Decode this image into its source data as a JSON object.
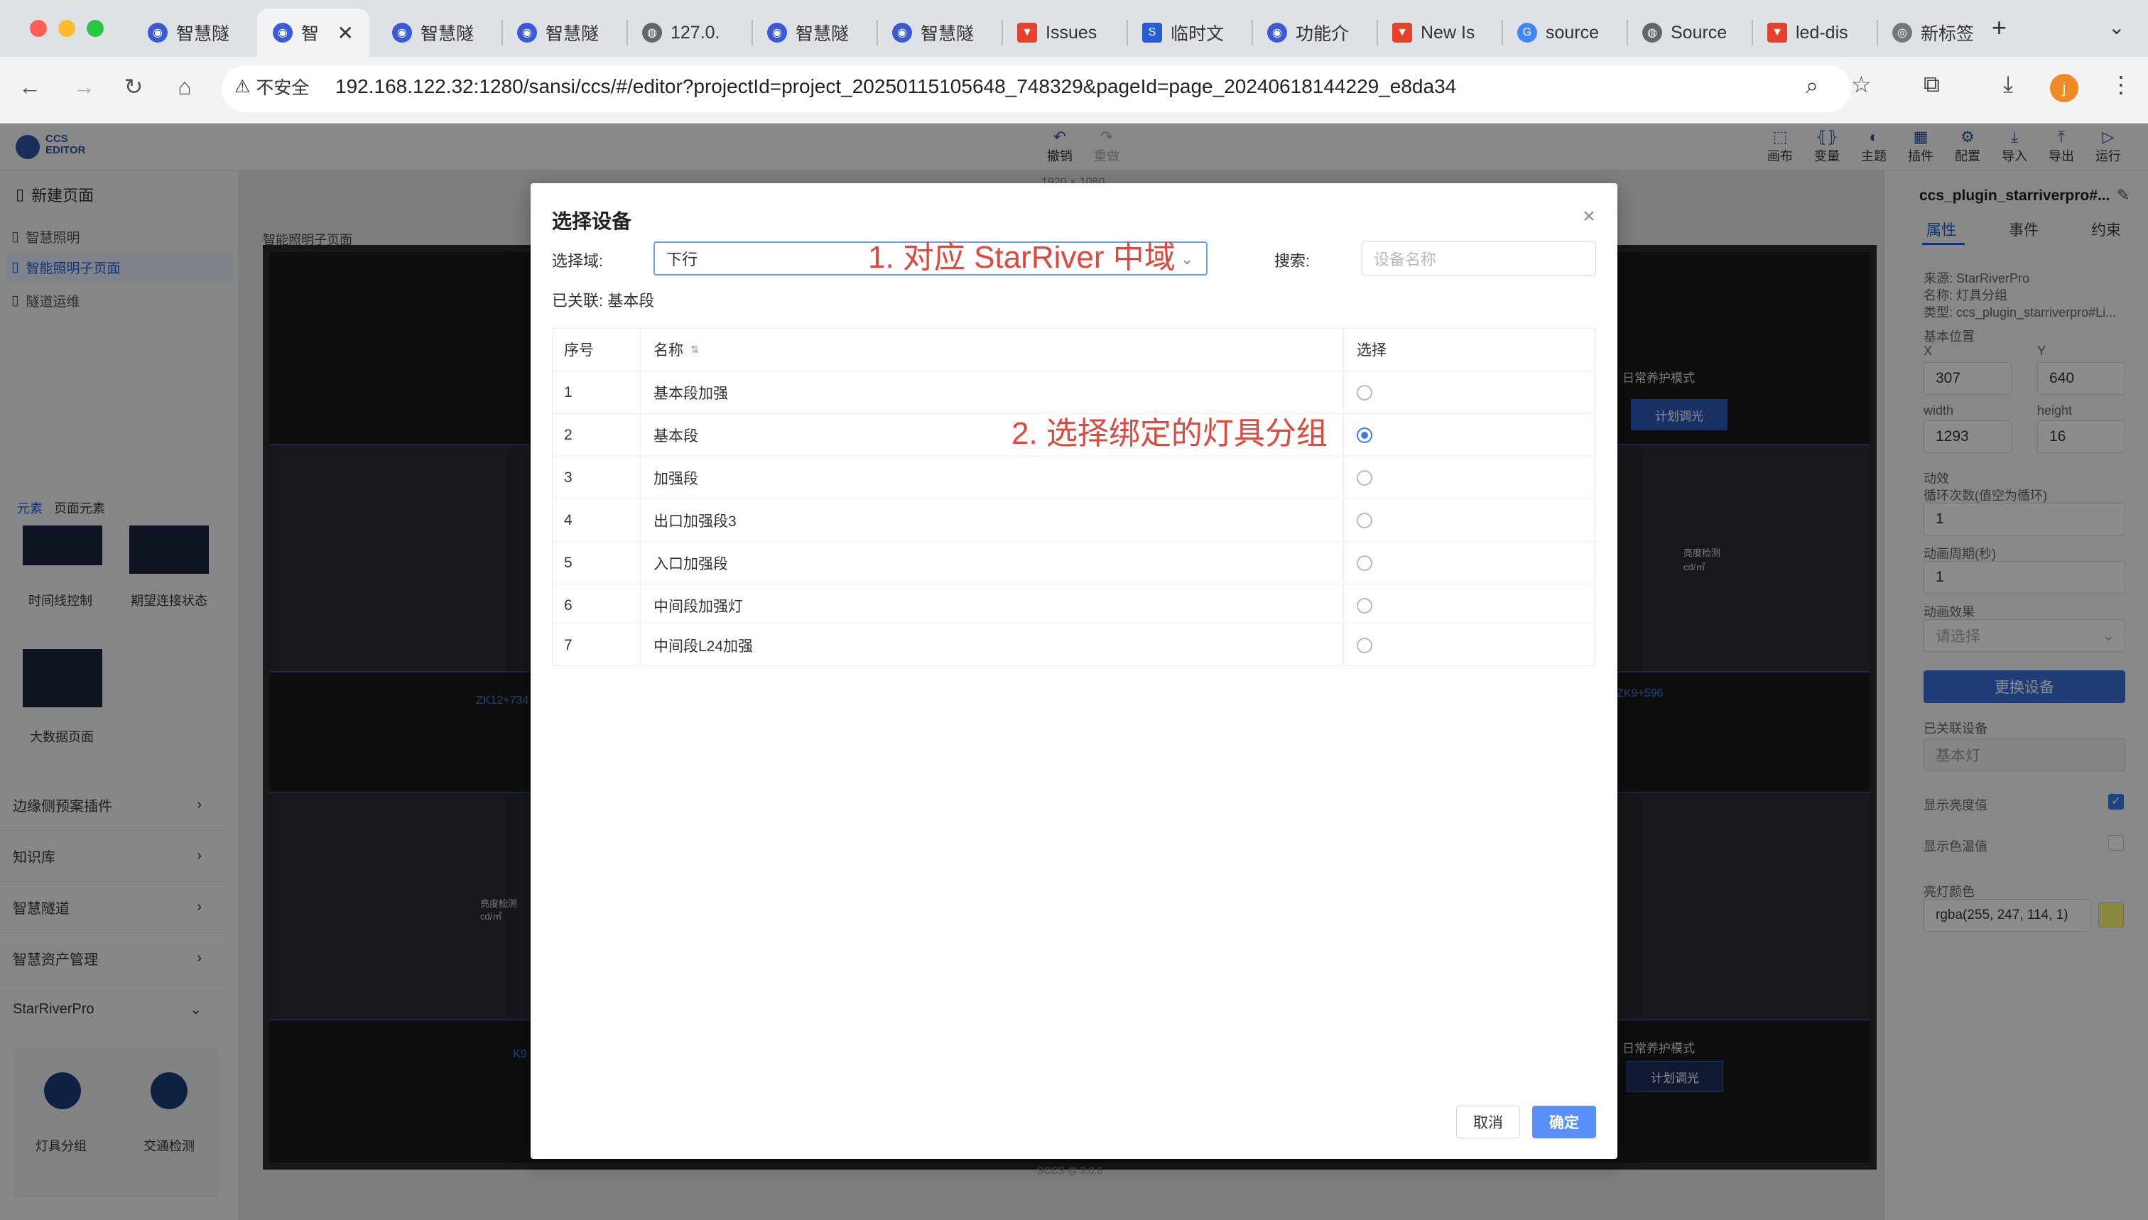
{
  "browser": {
    "tabs": [
      {
        "label": "智慧隧",
        "favicon": "ccs-icon"
      },
      {
        "label": "智",
        "favicon": "ccs-icon"
      },
      {
        "label": "智慧隧",
        "favicon": "ccs-icon"
      },
      {
        "label": "智慧隧",
        "favicon": "ccs-icon"
      },
      {
        "label": "127.0.",
        "favicon": "globe-icon"
      },
      {
        "label": "智慧隧",
        "favicon": "ccs-icon"
      },
      {
        "label": "智慧隧",
        "favicon": "ccs-icon"
      },
      {
        "label": "Issues",
        "favicon": "gitlab-icon"
      },
      {
        "label": "临时文",
        "favicon": "s-icon"
      },
      {
        "label": "功能介",
        "favicon": "ccs-icon"
      },
      {
        "label": "New Is",
        "favicon": "gitlab-icon"
      },
      {
        "label": "source",
        "favicon": "google-icon"
      },
      {
        "label": "Source",
        "favicon": "globe-icon"
      },
      {
        "label": "led-dis",
        "favicon": "gitlab-icon"
      },
      {
        "label": "新标签",
        "favicon": "chrome-icon"
      }
    ],
    "security_label": "不安全",
    "url": "192.168.122.32:1280/sansi/ccs/#/editor?projectId=project_20250115105648_748329&pageId=page_20240618144229_e8da34",
    "profile_initial": "j"
  },
  "app": {
    "logo_line1": "CCS",
    "logo_line2": "EDITOR",
    "undo_label": "撤销",
    "redo_label": "重做",
    "canvas_size": "1920 × 1080",
    "tools": [
      "画布",
      "变量",
      "主题",
      "插件",
      "配置",
      "导入",
      "导出",
      "运行"
    ],
    "footer": "SCCS @ 3.0.6"
  },
  "sidebar": {
    "new_page": "新建页面",
    "pages": [
      "智慧照明",
      "智能照明子页面",
      "隧道运维"
    ],
    "tabs": [
      "元素",
      "页面元素"
    ],
    "elements": [
      "时间线控制",
      "期望连接状态",
      "大数据页面"
    ],
    "groups": [
      "边缘侧预案插件",
      "知识库",
      "智慧隧道",
      "智慧资产管理",
      "StarRiverPro"
    ],
    "plugins": [
      "灯具分组",
      "交通检测"
    ]
  },
  "canvas": {
    "page_label": "智能照明子页面",
    "labels": [
      "日常养护模式",
      "计划调光",
      "亮度检测",
      "cd/㎡",
      "ZK12+734",
      "ZK9+596",
      "K9",
      "日常养护模式",
      "计划调光",
      "亮度检测",
      "cd/㎡"
    ]
  },
  "right_panel": {
    "title": "ccs_plugin_starriverpro#...",
    "tabs": [
      "属性",
      "事件",
      "约束"
    ],
    "source": "来源: StarRiverPro",
    "name": "名称: 灯具分组",
    "type": "类型: ccs_plugin_starriverpro#Li...",
    "basic_position": "基本位置",
    "x_label": "X",
    "x_value": "307",
    "y_label": "Y",
    "y_value": "640",
    "width_label": "width",
    "width_value": "1293",
    "height_label": "height",
    "height_value": "16",
    "motion_label": "动效",
    "loop_label": "循环次数(值空为循环)",
    "loop_value": "1",
    "period_label": "动画周期(秒)",
    "period_value": "1",
    "effect_label": "动画效果",
    "effect_placeholder": "请选择",
    "replace_button": "更换设备",
    "linked_label": "已关联设备",
    "linked_value": "基本灯",
    "show_brightness": "显示亮度值",
    "show_color_temp": "显示色温值",
    "light_color_label": "亮灯颜色",
    "light_color_value": "rgba(255, 247, 114, 1)"
  },
  "modal": {
    "title": "选择设备",
    "domain_label": "选择域:",
    "domain_value": "下行",
    "search_label": "搜索:",
    "search_placeholder": "设备名称",
    "linked_text": "已关联: 基本段",
    "columns": [
      "序号",
      "名称",
      "选择"
    ],
    "rows": [
      {
        "index": "1",
        "name": "基本段加强",
        "selected": false
      },
      {
        "index": "2",
        "name": "基本段",
        "selected": true
      },
      {
        "index": "3",
        "name": "加强段",
        "selected": false
      },
      {
        "index": "4",
        "name": "出口加强段3",
        "selected": false
      },
      {
        "index": "5",
        "name": "入口加强段",
        "selected": false
      },
      {
        "index": "6",
        "name": "中间段加强灯",
        "selected": false
      },
      {
        "index": "7",
        "name": "中间段L24加强",
        "selected": false
      }
    ],
    "cancel_label": "取消",
    "ok_label": "确定",
    "annotation_1": "1. 对应 StarRiver 中域",
    "annotation_2": "2. 选择绑定的灯具分组"
  },
  "colors": {
    "accent": "#3a7bea",
    "annotation": "#e0473d",
    "primary_button": "#5b8ff9"
  }
}
